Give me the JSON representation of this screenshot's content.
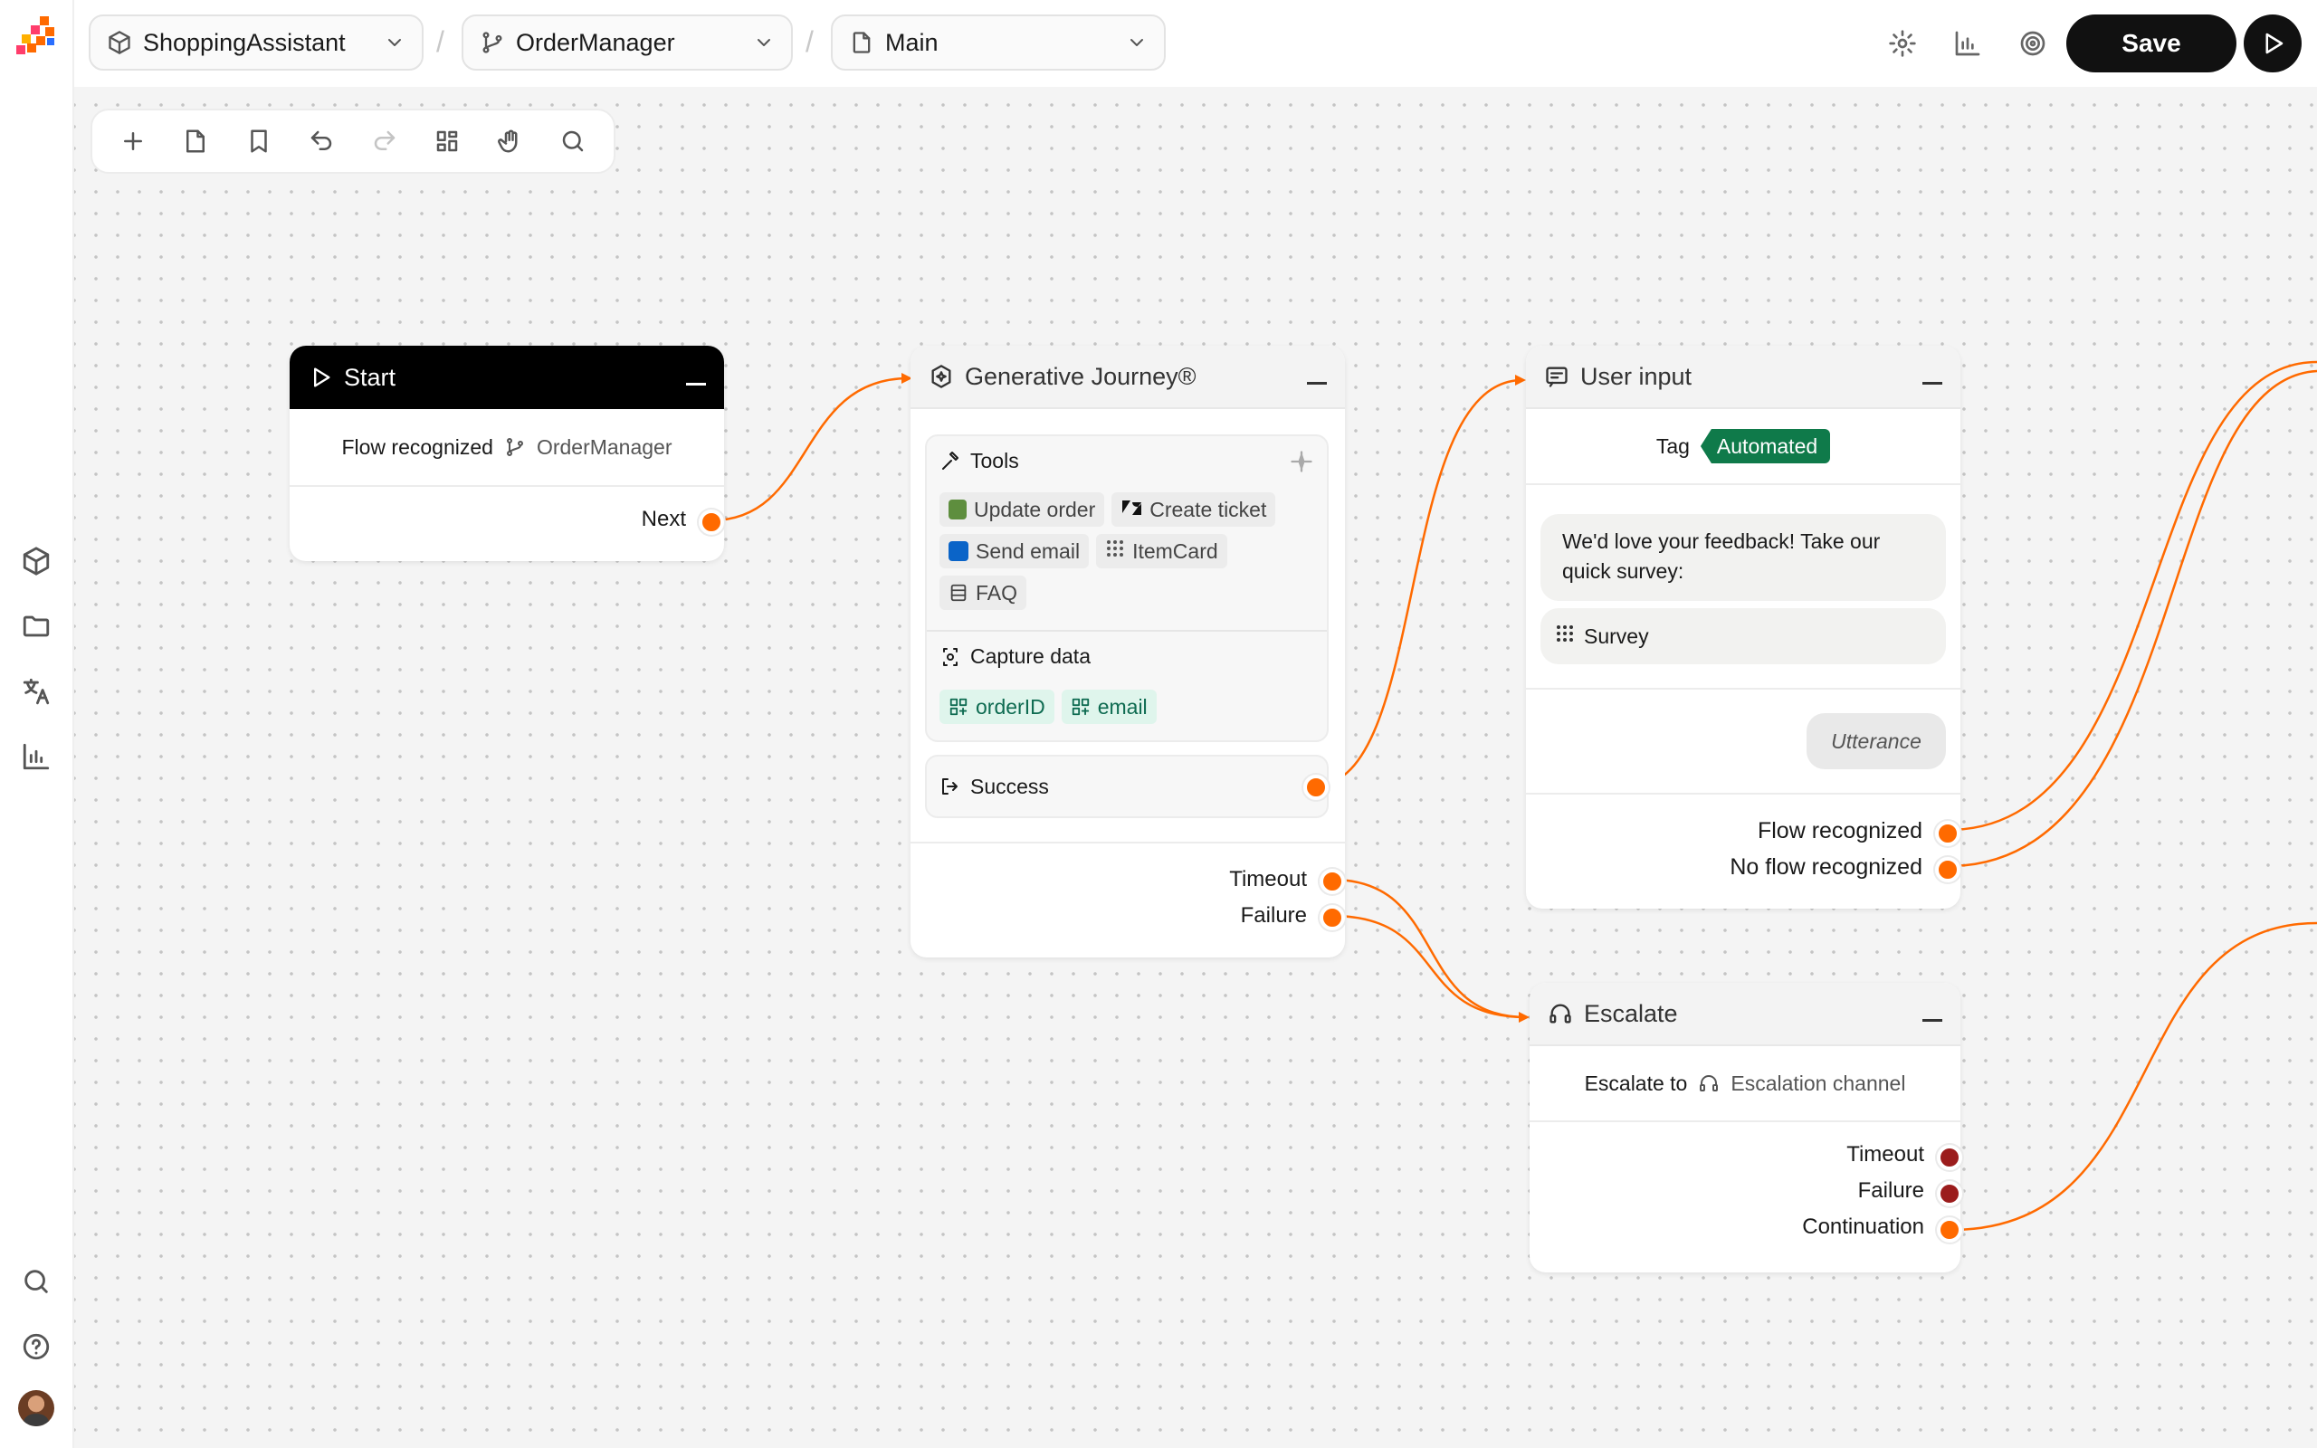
{
  "breadcrumbs": [
    {
      "label": "ShoppingAssistant",
      "icon": "cube-icon"
    },
    {
      "label": "OrderManager",
      "icon": "branch-icon"
    },
    {
      "label": "Main",
      "icon": "file-icon"
    }
  ],
  "breadcrumb_separator": "/",
  "header": {
    "save_label": "Save"
  },
  "colors": {
    "accent": "#ff6a00",
    "error_port": "#9b1c1c",
    "tag_green": "#0f7a4a",
    "capture_chip": "#dff5ec"
  },
  "nodes": {
    "start": {
      "title": "Start",
      "flow_label": "Flow recognized",
      "flow_value": "OrderManager",
      "outputs": [
        "Next"
      ]
    },
    "genjourney": {
      "title": "Generative Journey®",
      "tools_label": "Tools",
      "tools": [
        "Update order",
        "Create ticket",
        "Send email",
        "ItemCard",
        "FAQ"
      ],
      "capture_label": "Capture data",
      "capture": [
        "orderID",
        "email"
      ],
      "success_label": "Success",
      "outputs": [
        "Timeout",
        "Failure"
      ]
    },
    "userinput": {
      "title": "User input",
      "tag_label": "Tag",
      "tag_value": "Automated",
      "message": "We'd love your feedback! Take our quick survey:",
      "survey_label": "Survey",
      "utterance": "Utterance",
      "outputs": [
        "Flow recognized",
        "No flow recognized"
      ]
    },
    "escalate": {
      "title": "Escalate",
      "escalate_label": "Escalate to",
      "escalate_value": "Escalation channel",
      "outputs": [
        "Timeout",
        "Failure",
        "Continuation"
      ]
    }
  }
}
